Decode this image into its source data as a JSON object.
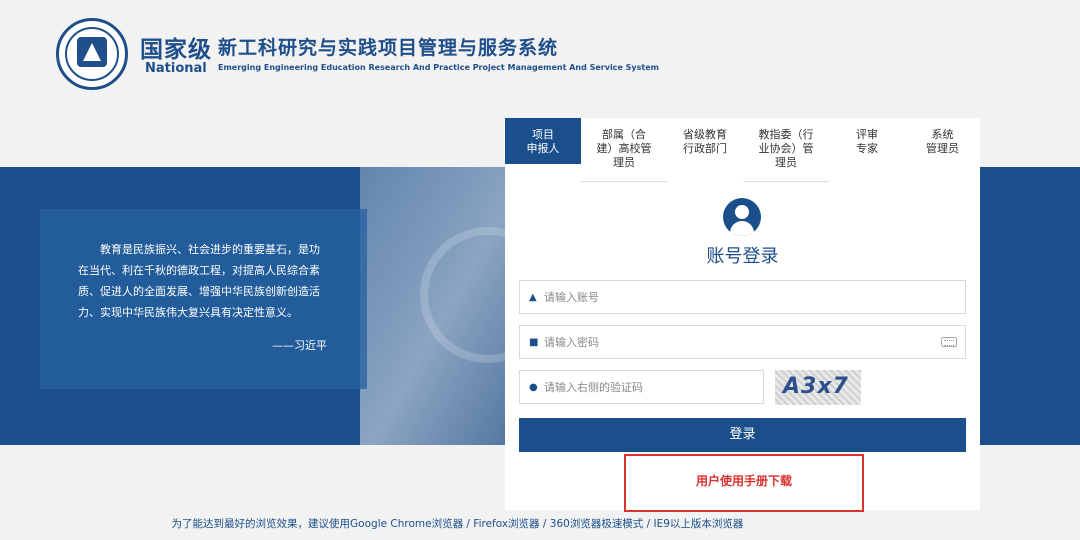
{
  "header": {
    "brand_cn": "国家级",
    "brand_en": "National",
    "system_cn": "新工科研究与实践项目管理与服务系统",
    "system_en": "Emerging Engineering Education Research And Practice Project Management And Service System"
  },
  "banner": {
    "quote": "教育是民族振兴、社会进步的重要基石，是功在当代、利在千秋的德政工程，对提高人民综合素质、促进人的全面发展、增强中华民族创新创造活力、实现中华民族伟大复兴具有决定性意义。",
    "author": "——习近平"
  },
  "tabs": [
    {
      "label": "项目\n申报人",
      "active": true
    },
    {
      "label": "部属（合\n建）高校管\n理员",
      "active": false
    },
    {
      "label": "省级教育\n行政部门",
      "active": false
    },
    {
      "label": "教指委（行\n业协会）管\n理员",
      "active": false
    },
    {
      "label": "评审\n专家",
      "active": false
    },
    {
      "label": "系统\n管理员",
      "active": false
    }
  ],
  "login": {
    "title": "账号登录",
    "account_placeholder": "请输入账号",
    "password_placeholder": "请输入密码",
    "captcha_placeholder": "请输入右侧的验证码",
    "captcha_text": "A3x7",
    "button_label": "登录",
    "manual_link": "用户使用手册下载"
  },
  "footer": {
    "text": "为了能达到最好的浏览效果，建议使用Google Chrome浏览器 / Firefox浏览器 / 360浏览器极速模式 / IE9以上版本浏览器"
  },
  "colors": {
    "primary": "#1b4f8b",
    "highlight": "#d9322f"
  }
}
